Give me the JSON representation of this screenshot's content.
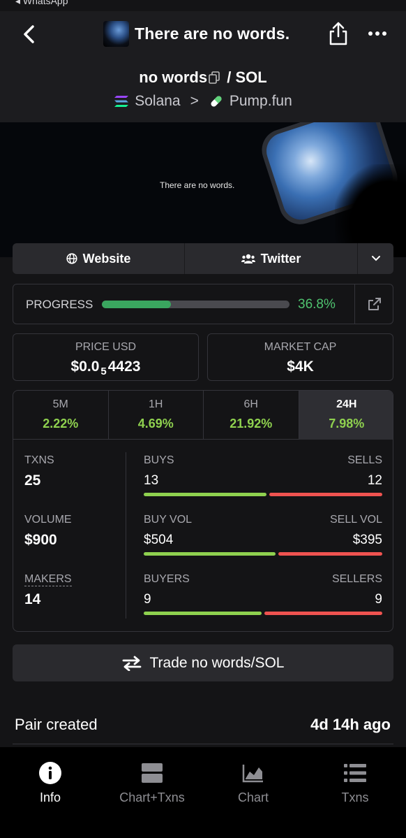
{
  "statusbar": {
    "back_app": "◂ WhatsApp"
  },
  "nav": {
    "title": "There are no words."
  },
  "pair": {
    "base": "no words",
    "separator": "/",
    "quote": "SOL",
    "chain": "Solana",
    "chevron": ">",
    "dex": "Pump.fun"
  },
  "banner": {
    "text": "There are no words."
  },
  "links": {
    "website": "Website",
    "twitter": "Twitter"
  },
  "progress": {
    "label": "PROGRESS",
    "value_text": "36.8%",
    "fraction": 0.368
  },
  "price": {
    "label": "PRICE USD",
    "prefix": "$0.0",
    "zeros": "5",
    "suffix": "4423"
  },
  "market_cap": {
    "label": "MARKET CAP",
    "value": "$4K"
  },
  "timeframes": [
    {
      "name": "5M",
      "change": "2.22%"
    },
    {
      "name": "1H",
      "change": "4.69%"
    },
    {
      "name": "6H",
      "change": "21.92%"
    },
    {
      "name": "24H",
      "change": "7.98%",
      "active": true
    }
  ],
  "metrics": {
    "txns": {
      "label": "TXNS",
      "value": "25"
    },
    "volume": {
      "label": "VOLUME",
      "value": "$900"
    },
    "makers": {
      "label": "MAKERS",
      "value": "14"
    },
    "buys": {
      "label": "BUYS",
      "value": "13"
    },
    "sells": {
      "label": "SELLS",
      "value": "12"
    },
    "buy_vol": {
      "label": "BUY VOL",
      "value": "$504"
    },
    "sell_vol": {
      "label": "SELL VOL",
      "value": "$395"
    },
    "buyers": {
      "label": "BUYERS",
      "value": "9"
    },
    "sellers": {
      "label": "SELLERS",
      "value": "9"
    },
    "ratios": {
      "buys_sells": 0.52,
      "buyvol_sellvol": 0.56,
      "buyers_sellers": 0.5
    }
  },
  "trade": {
    "label": "Trade no words/SOL"
  },
  "pair_created": {
    "label": "Pair created",
    "value": "4d 14h ago"
  },
  "tabs": [
    {
      "label": "Info",
      "icon": "info-icon",
      "active": true
    },
    {
      "label": "Chart+Txns",
      "icon": "chart-txns-icon"
    },
    {
      "label": "Chart",
      "icon": "area-chart-icon"
    },
    {
      "label": "Txns",
      "icon": "list-icon"
    }
  ],
  "colors": {
    "green": "#8fd14f",
    "red": "#ef5350",
    "progress_green": "#3aa65f",
    "bg": "#141416"
  }
}
